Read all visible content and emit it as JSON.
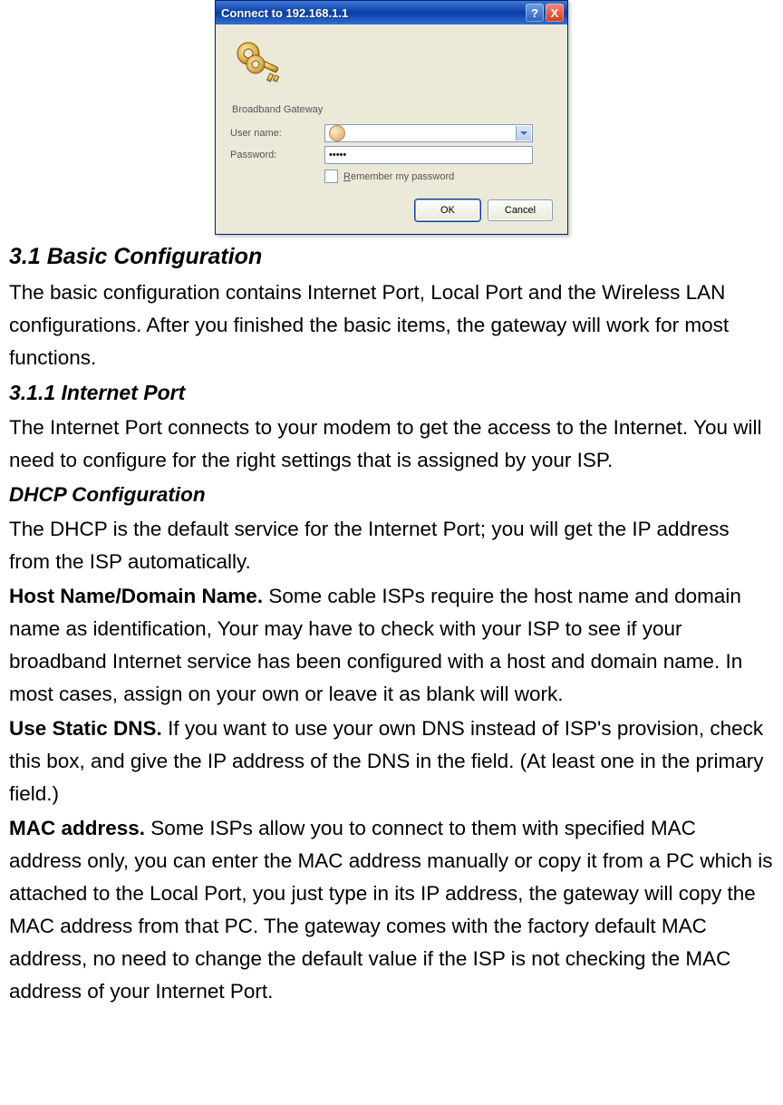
{
  "dialog": {
    "title": "Connect to 192.168.1.1",
    "help_glyph": "?",
    "close_glyph": "X",
    "realm": "Broadband Gateway",
    "username_label": "User name:",
    "username_value": "",
    "password_label": "Password:",
    "password_value": "•••••",
    "remember_prefix": "R",
    "remember_rest": "emember my password",
    "ok_label": "OK",
    "cancel_label": "Cancel"
  },
  "doc": {
    "h1": "3.1 Basic Configuration",
    "p1": "The basic configuration contains Internet Port, Local Port and the Wireless LAN configurations. After you finished the basic items, the gateway will work for most functions.",
    "h2": "3.1.1 Internet Port",
    "p2": "The Internet Port connects to your modem to get the access to the Internet. You will need to configure for the right settings that is assigned by your ISP.",
    "h3": "DHCP Configuration",
    "p3": "The DHCP is the default service for the Internet Port; you will get the IP address from the ISP automatically.",
    "p4_lead": "Host Name/Domain Name.",
    "p4_rest": " Some cable ISPs require the host name and domain name as identification, Your may have to check with your ISP to see if your broadband Internet service has been configured with a host and domain name. In most cases, assign on your own or leave it as blank will work.",
    "p5_lead": "Use Static DNS.",
    "p5_rest": " If you want to use your own DNS instead of ISP's provision, check this box, and give the IP address of the DNS in the field. (At least one in the primary field.)",
    "p6_lead": "MAC address.",
    "p6_rest": " Some ISPs allow you to connect to them with specified MAC address only, you can enter the MAC address manually or copy it from a PC which is attached to the Local Port, you just type in its IP address, the gateway will copy the MAC address from that PC. The gateway comes with the factory default MAC address, no need to change the default value if the ISP is not checking the MAC address of your Internet Port."
  }
}
